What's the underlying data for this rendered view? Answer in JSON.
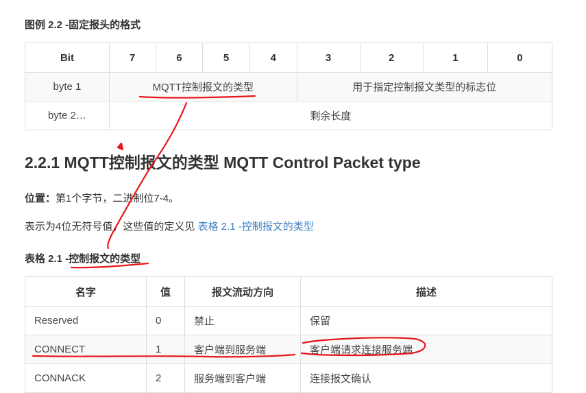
{
  "caption1": "图例 2.2 -固定报头的格式",
  "table1": {
    "header": [
      "Bit",
      "7",
      "6",
      "5",
      "4",
      "3",
      "2",
      "1",
      "0"
    ],
    "row1": {
      "label": "byte 1",
      "type_field": "MQTT控制报文的类型",
      "flags_field": "用于指定控制报文类型的标志位"
    },
    "row2": {
      "label": "byte 2…",
      "remaining": "剩余长度"
    }
  },
  "heading": "2.2.1 MQTT控制报文的类型 MQTT Control Packet type",
  "position": {
    "label": "位置：",
    "text": "第1个字节，二进制位7-4。"
  },
  "desc": {
    "text": "表示为4位无符号值，这些值的定义见 ",
    "link": "表格 2.1 -控制报文的类型"
  },
  "caption2": "表格 2.1 -控制报文的类型",
  "table2": {
    "columns": [
      "名字",
      "值",
      "报文流动方向",
      "描述"
    ],
    "rows": [
      [
        "Reserved",
        "0",
        "禁止",
        "保留"
      ],
      [
        "CONNECT",
        "1",
        "客户端到服务端",
        "客户端请求连接服务端"
      ],
      [
        "CONNACK",
        "2",
        "服务端到客户端",
        "连接报文确认"
      ]
    ]
  },
  "colors": {
    "link": "#3d7fc1",
    "border": "#dddddd",
    "stripe": "#f9f9f9",
    "annotation": "#e8141b"
  }
}
